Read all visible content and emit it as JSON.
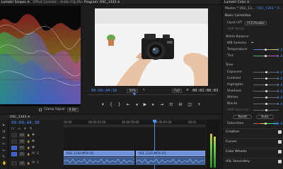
{
  "scopes": {
    "tabs": [
      "Lumetri Scopes ≡",
      "Effect Controls",
      "Audio Clip Mixer: OSC_1343",
      "M"
    ],
    "active_tab": 0,
    "footer": {
      "clamp_label": "Clamp Signal",
      "mode": "8 Bit"
    }
  },
  "program": {
    "title": "Program: OSC_1343 ≡",
    "timecode": "00:00:44:30",
    "zoom": "50%",
    "quality": "Full",
    "duration": "00:02:00:03",
    "controls": [
      "marker-icon",
      "in-point-icon",
      "out-point-icon",
      "go-to-in-icon",
      "step-back-icon",
      "play-icon",
      "step-forward-icon",
      "go-to-out-icon",
      "lift-icon",
      "extract-icon",
      "export-frame-icon"
    ]
  },
  "lumetri": {
    "title": "Lumetri Color ≡",
    "master": "Master * OSC_13...",
    "clip": "OSC_1343 * O...",
    "basic_correction": "Basic Correction",
    "input_lut_label": "Input LUT",
    "input_lut_value": "FCC/Arabic",
    "hdr_white": "HDR White",
    "white_balance": "White Balance",
    "wb_selector": "WB Selector",
    "temperature_label": "Temperature",
    "tint_label": "Tint",
    "tone": "Tone",
    "tone_rows": [
      {
        "label": "Exposure",
        "value": "0.0",
        "knob": 0.5
      },
      {
        "label": "Contrast",
        "value": "0.0",
        "knob": 0.5
      },
      {
        "label": "Highlights",
        "value": "0.0",
        "knob": 0.5
      },
      {
        "label": "Shadows",
        "value": "0.0",
        "knob": 0.5
      },
      {
        "label": "Whites",
        "value": "0.0",
        "knob": 0.5
      },
      {
        "label": "Blacks",
        "value": "0.0",
        "knob": 0.5
      },
      {
        "label": "HDR Specular",
        "value": "",
        "knob": 0.5
      }
    ],
    "reset_label": "Reset",
    "auto_label": "Auto",
    "saturation_label": "Saturation",
    "saturation_value": "100.0",
    "temperature_value": "0.0",
    "tint_value": "0.0",
    "sections": [
      "Creative",
      "Curves",
      "Color Wheels",
      "HSL Secondary"
    ]
  },
  "timeline": {
    "tab": "OSC_1343 ≡",
    "timecode": "00:00:44:30",
    "ruler": [
      "00:00",
      "00:00:15:00",
      "00:00:30:00",
      "00:00:45:00",
      "00:01"
    ],
    "video_tracks": [
      "V3",
      "V2",
      "V1"
    ],
    "audio_tracks": [
      "A1",
      "A2"
    ],
    "clips": [
      {
        "label": "OSC_1343.MOV [V]",
        "track": "V1"
      },
      {
        "label": "OSC_1343.MOV [V]",
        "track": "V1"
      }
    ]
  },
  "colors": {
    "accent": "#4a90ff",
    "clip_video": "#6f91d9",
    "clip_audio": "#3b5c93"
  }
}
